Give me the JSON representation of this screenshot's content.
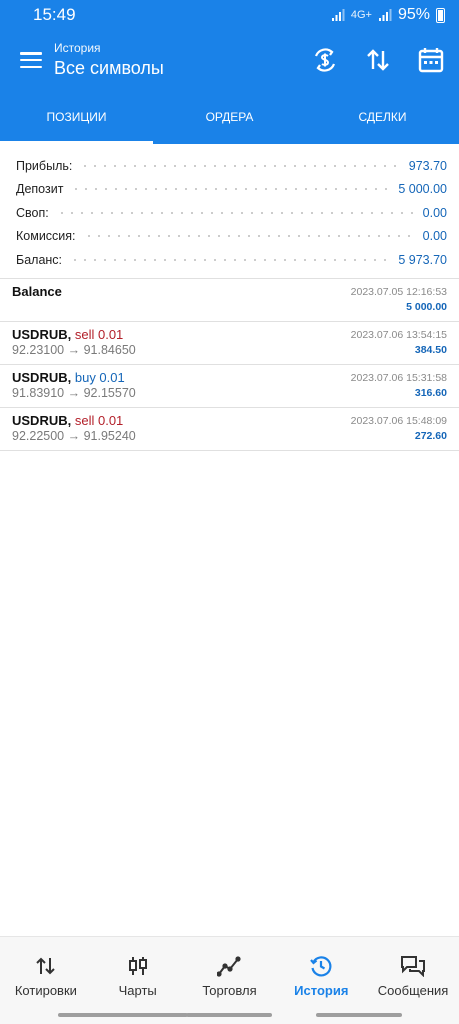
{
  "status": {
    "time": "15:49",
    "network": "4G+",
    "battery": "95%"
  },
  "header": {
    "subtitle": "История",
    "title": "Все символы"
  },
  "header_icons": [
    "currency-exchange-icon",
    "sort-icon",
    "calendar-icon"
  ],
  "tabs": [
    {
      "label": "ПОЗИЦИИ",
      "active": true
    },
    {
      "label": "ОРДЕРА",
      "active": false
    },
    {
      "label": "СДЕЛКИ",
      "active": false
    }
  ],
  "summary": [
    {
      "label": "Прибыль:",
      "value": "973.70"
    },
    {
      "label": "Депозит",
      "value": "5 000.00"
    },
    {
      "label": "Своп:",
      "value": "0.00"
    },
    {
      "label": "Комиссия:",
      "value": "0.00"
    },
    {
      "label": "Баланс:",
      "value": "5 973.70"
    }
  ],
  "balance_entry": {
    "label": "Balance",
    "time": "2023.07.05 12:16:53",
    "amount": "5 000.00"
  },
  "deals": [
    {
      "symbol": "USDRUB,",
      "side": "sell 0.01",
      "type": "sell",
      "prices": "92.23100 → 91.84650",
      "time": "2023.07.06 13:54:15",
      "profit": "384.50"
    },
    {
      "symbol": "USDRUB,",
      "side": "buy 0.01",
      "type": "buy",
      "prices": "91.83910 → 92.15570",
      "time": "2023.07.06 15:31:58",
      "profit": "316.60"
    },
    {
      "symbol": "USDRUB,",
      "side": "sell 0.01",
      "type": "sell",
      "prices": "92.22500 → 91.95240",
      "time": "2023.07.06 15:48:09",
      "profit": "272.60"
    }
  ],
  "nav": [
    {
      "label": "Котировки",
      "icon": "quotes-icon",
      "active": false
    },
    {
      "label": "Чарты",
      "icon": "candlestick-icon",
      "active": false
    },
    {
      "label": "Торговля",
      "icon": "trade-icon",
      "active": false
    },
    {
      "label": "История",
      "icon": "history-icon",
      "active": true
    },
    {
      "label": "Сообщения",
      "icon": "messages-icon",
      "active": false
    }
  ],
  "colors": {
    "primary": "#1a82e8",
    "sell": "#b3202a",
    "buy": "#1566b8",
    "value": "#1566b8"
  }
}
